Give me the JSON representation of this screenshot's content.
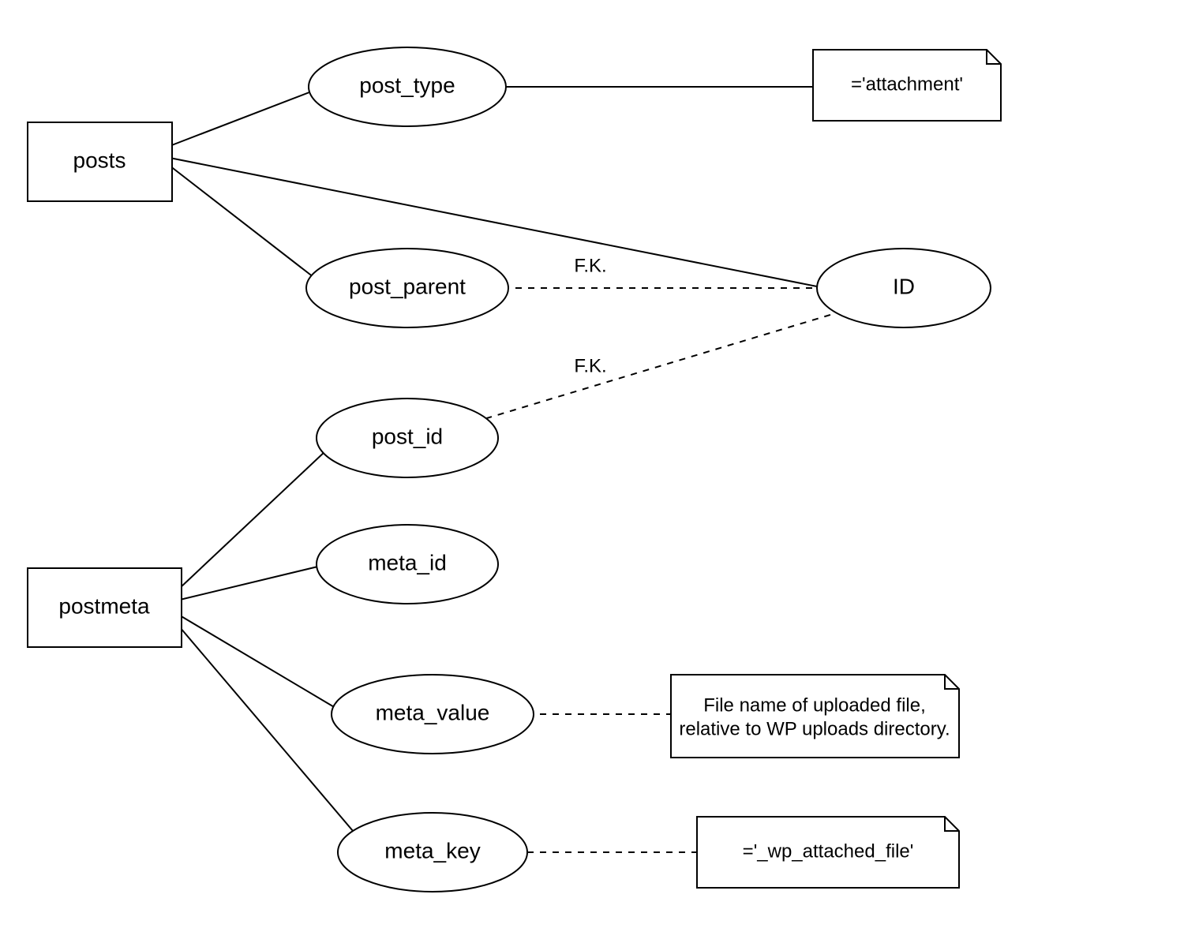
{
  "entities": {
    "posts": {
      "label": "posts"
    },
    "postmeta": {
      "label": "postmeta"
    }
  },
  "attributes": {
    "post_type": {
      "label": "post_type"
    },
    "post_parent": {
      "label": "post_parent"
    },
    "id": {
      "label": "ID"
    },
    "post_id": {
      "label": "post_id"
    },
    "meta_id": {
      "label": "meta_id"
    },
    "meta_value": {
      "label": "meta_value"
    },
    "meta_key": {
      "label": "meta_key"
    }
  },
  "notes": {
    "attachment": {
      "text": "='attachment'"
    },
    "meta_value": {
      "line1": "File name of uploaded file,",
      "line2": "relative to WP uploads directory."
    },
    "meta_key": {
      "text": "='_wp_attached_file'"
    }
  },
  "edge_labels": {
    "fk1": "F.K.",
    "fk2": "F.K."
  }
}
